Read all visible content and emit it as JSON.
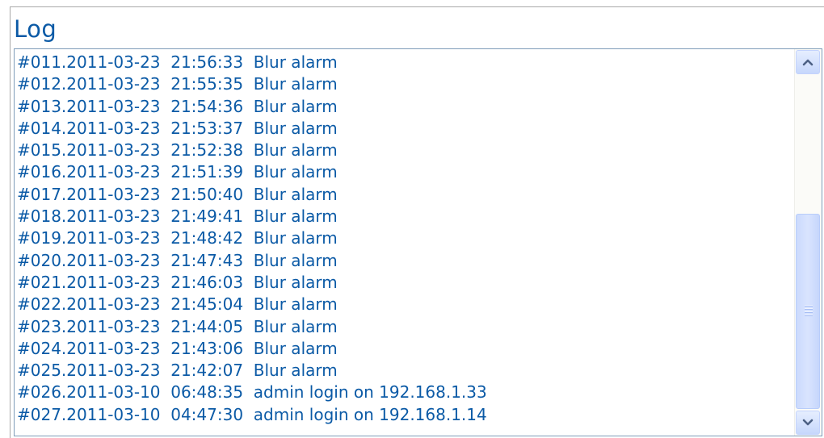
{
  "log": {
    "title": "Log",
    "entries": [
      "#011.2011-03-23  21:56:33  Blur alarm",
      "#012.2011-03-23  21:55:35  Blur alarm",
      "#013.2011-03-23  21:54:36  Blur alarm",
      "#014.2011-03-23  21:53:37  Blur alarm",
      "#015.2011-03-23  21:52:38  Blur alarm",
      "#016.2011-03-23  21:51:39  Blur alarm",
      "#017.2011-03-23  21:50:40  Blur alarm",
      "#018.2011-03-23  21:49:41  Blur alarm",
      "#019.2011-03-23  21:48:42  Blur alarm",
      "#020.2011-03-23  21:47:43  Blur alarm",
      "#021.2011-03-23  21:46:03  Blur alarm",
      "#022.2011-03-23  21:45:04  Blur alarm",
      "#023.2011-03-23  21:44:05  Blur alarm",
      "#024.2011-03-23  21:43:06  Blur alarm",
      "#025.2011-03-23  21:42:07  Blur alarm",
      "#026.2011-03-10  06:48:35  admin login on 192.168.1.33",
      "#027.2011-03-10  04:47:30  admin login on 192.168.1.14"
    ],
    "scrollbar": {
      "up_icon": "chevron-up-icon",
      "down_icon": "chevron-down-icon",
      "grip_icon": "grip-lines-icon"
    }
  },
  "colors": {
    "text": "#0b5aa6",
    "border": "#7f9db9",
    "scrollbar_button": "#c6d7fc",
    "scrollbar_arrow": "#4d6185"
  }
}
